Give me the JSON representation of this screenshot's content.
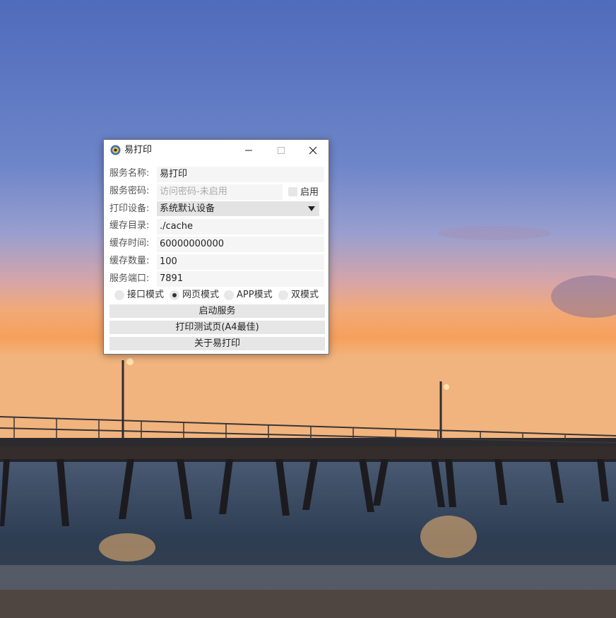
{
  "window": {
    "title": "易打印",
    "controls": {
      "minimize": "minimize-icon",
      "maximize": "maximize-icon",
      "close": "close-icon"
    }
  },
  "form": {
    "service_name": {
      "label": "服务名称:",
      "value": "易打印"
    },
    "service_password": {
      "label": "服务密码:",
      "placeholder": "访问密码-未启用",
      "value": "",
      "enable_label": "启用",
      "enabled": false
    },
    "print_device": {
      "label": "打印设备:",
      "value": "系统默认设备"
    },
    "cache_dir": {
      "label": "缓存目录:",
      "value": "./cache"
    },
    "cache_time": {
      "label": "缓存时间:",
      "value": "60000000000"
    },
    "cache_count": {
      "label": "缓存数量:",
      "value": "100"
    },
    "service_port": {
      "label": "服务端口:",
      "value": "7891"
    }
  },
  "modes": [
    {
      "label": "接口模式",
      "selected": false
    },
    {
      "label": "网页模式",
      "selected": true
    },
    {
      "label": "APP模式",
      "selected": false
    },
    {
      "label": "双模式",
      "selected": false
    }
  ],
  "buttons": {
    "start": "启动服务",
    "test_print": "打印测试页(A4最佳)",
    "about": "关于易打印"
  }
}
